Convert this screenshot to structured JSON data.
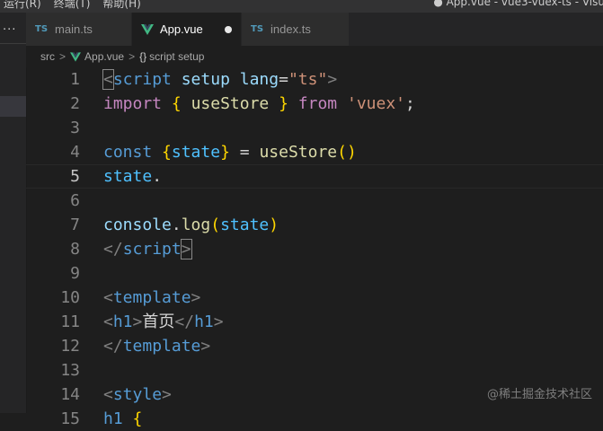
{
  "menu": [
    "运行(R)",
    "终端(T)",
    "帮助(H)"
  ],
  "window_title": "● App.vue - vue3-vuex-ts - Visu",
  "tabs": [
    {
      "icon": "TS",
      "label": "main.ts",
      "active": false
    },
    {
      "icon": "vue-logo",
      "label": "App.vue",
      "active": true,
      "dirty": true
    },
    {
      "icon": "TS",
      "label": "index.ts",
      "active": false
    }
  ],
  "breadcrumb": {
    "folder": "src",
    "file": "App.vue",
    "symbol_icon": "{}",
    "symbol": "script setup"
  },
  "editor": {
    "current_line": 5,
    "line_numbers": [
      "1",
      "2",
      "3",
      "4",
      "5",
      "6",
      "7",
      "8",
      "9",
      "10",
      "11",
      "12",
      "13",
      "14",
      "15"
    ]
  },
  "watermark": "@稀土掘金技术社区",
  "colors": {
    "editor_bg": "#1e1e1e",
    "tab_active_bg": "#1e1e1e",
    "tab_inactive_bg": "#2d2d2d",
    "ts_icon": "#519aba",
    "vue_icon": "#41b883"
  }
}
